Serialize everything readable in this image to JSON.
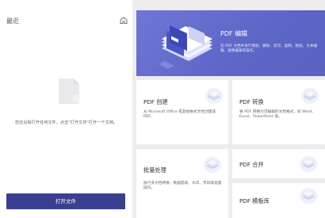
{
  "recent": {
    "title": "最近",
    "empty_text": "您还没有打开任何文件，点击\"打开文件\"打开一个文档。",
    "open_button": "打开文件"
  },
  "hero": {
    "title": "PDF 编辑",
    "description": "在 PDF 文档中进行添加、删除、剪切、复制、粘贴、文本编辑、图像编辑等操作。"
  },
  "cards": [
    {
      "title": "PDF 创建",
      "description": "从 Microsoft Office 或其他格式文档创建成 PDF。"
    },
    {
      "title": "PDF 转换",
      "description": "将 PDF 转换为可编辑的文档格式，如 Word、Excel、PowerPoint 等。"
    },
    {
      "title": "批量处理",
      "description": "执行多文档转换、数据提取、水印、页码等批量操作。"
    },
    {
      "title": "PDF 合并",
      "description": ""
    },
    {
      "title": "PDF 模板库",
      "description": ""
    }
  ],
  "colors": {
    "accent": "#3b3f8f",
    "hero_bg": "#6e77d4",
    "panel_bg": "#ffffff",
    "page_bg": "#ededf0"
  },
  "icons": {
    "home": "home-icon",
    "empty": "document-icon",
    "cards": "stacked-pages-icon"
  }
}
